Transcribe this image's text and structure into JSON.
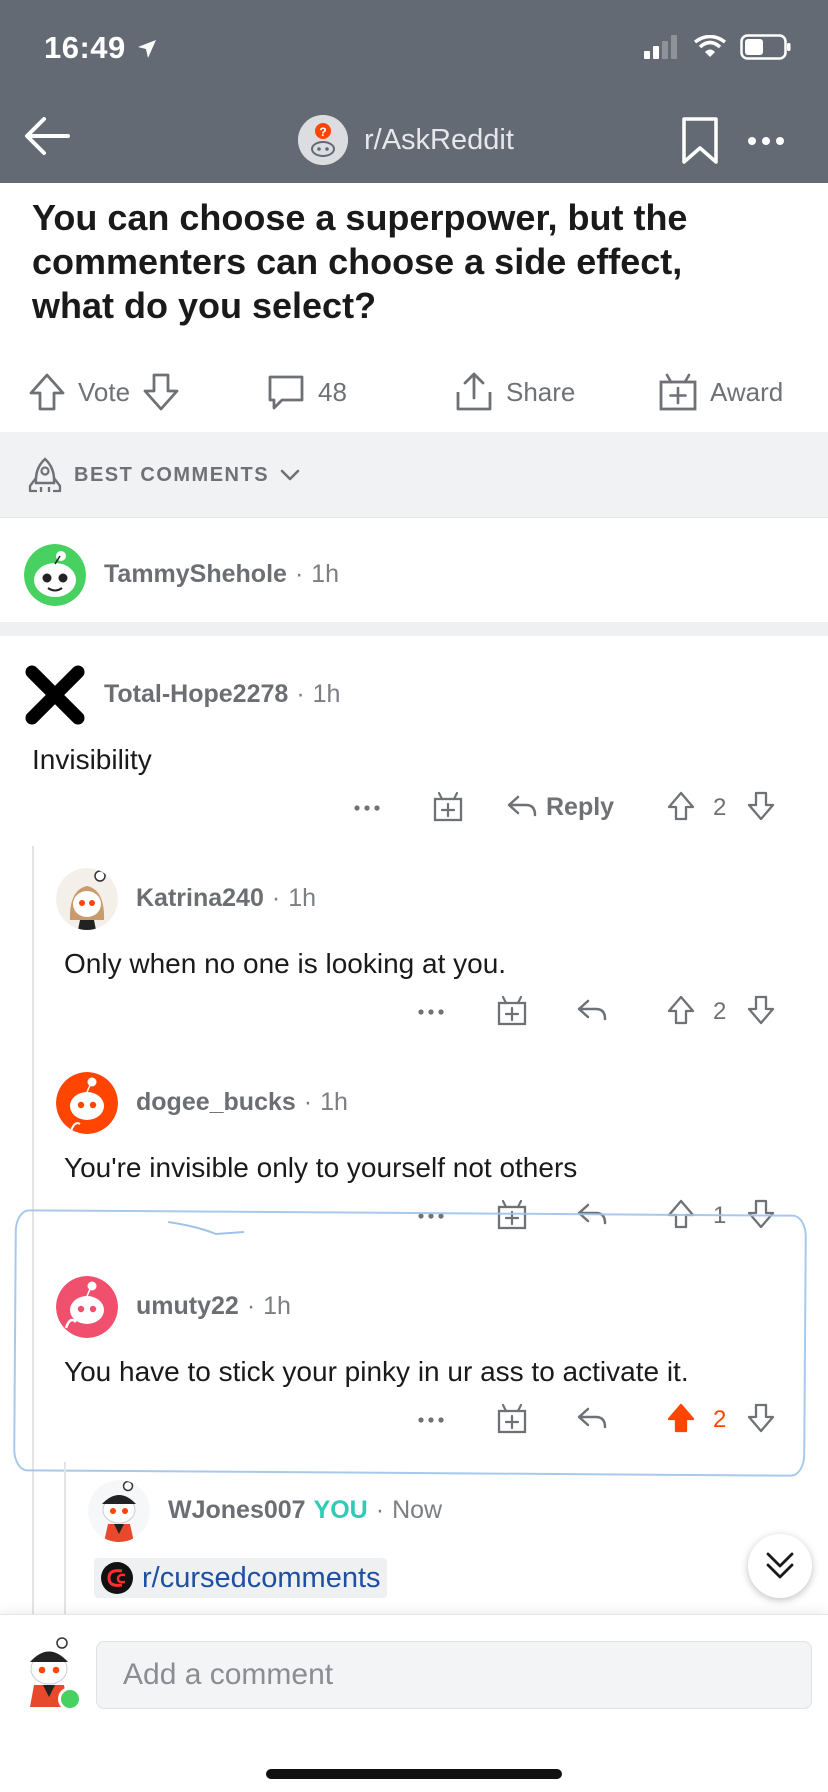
{
  "status_bar": {
    "time": "16:49"
  },
  "header": {
    "subreddit": "r/AskReddit"
  },
  "post": {
    "title": "You can choose a superpower, but the commenters can choose a side effect, what do you select?",
    "vote_label": "Vote",
    "comment_count": "48",
    "share_label": "Share",
    "award_label": "Award"
  },
  "sort": {
    "label": "BEST COMMENTS"
  },
  "comments": [
    {
      "user": "TammyShehole",
      "time": "1h"
    },
    {
      "user": "Total-Hope2278",
      "time": "1h",
      "text": "Invisibility",
      "reply_label": "Reply",
      "votes": "2"
    },
    {
      "user": "Katrina240",
      "time": "1h",
      "text": "Only when no one is looking at you.",
      "votes": "2"
    },
    {
      "user": "dogee_bucks",
      "time": "1h",
      "text": "You're invisible only to yourself not others",
      "votes": "1"
    },
    {
      "user": "umuty22",
      "time": "1h",
      "text": "You have to stick your pinky in ur ass to activate it.",
      "votes": "2",
      "upvoted": true
    },
    {
      "user": "WJones007",
      "badge": "YOU",
      "time": "Now",
      "link": "r/cursedcomments"
    }
  ],
  "composer": {
    "placeholder": "Add a comment"
  },
  "colors": {
    "header_bg": "#646a73",
    "upvote": "#ff4500",
    "you_badge": "#2ecbb5",
    "link": "#1f4fa3"
  },
  "icons": [
    "back-arrow-icon",
    "bookmark-icon",
    "more-icon",
    "upvote-icon",
    "downvote-icon",
    "comment-bubble-icon",
    "share-icon",
    "gift-icon",
    "rocket-icon",
    "chevron-down-icon",
    "reply-icon",
    "double-chevron-down-icon"
  ]
}
